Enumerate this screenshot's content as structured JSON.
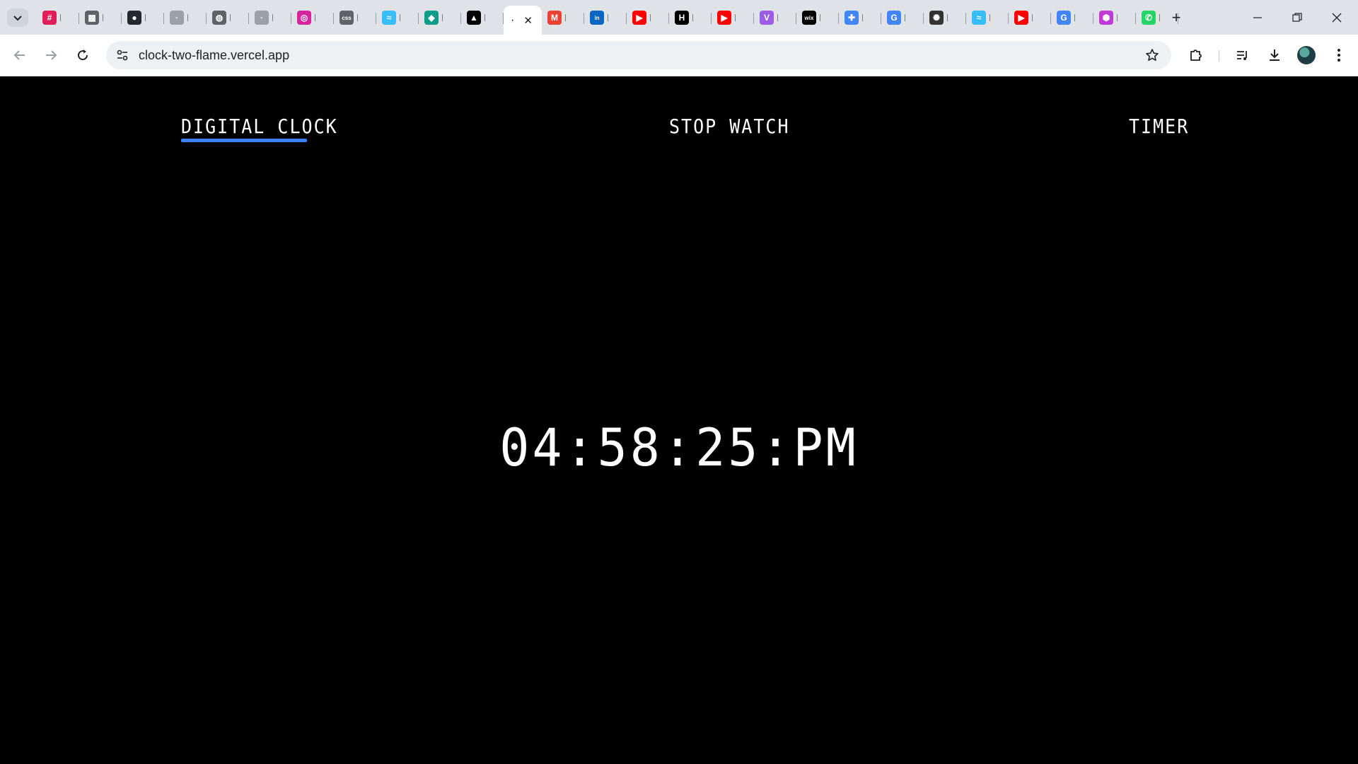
{
  "browser": {
    "tabs": [
      {
        "icon": "slack-icon",
        "color": "#e01e5a",
        "glyph": "#"
      },
      {
        "icon": "figma-icon",
        "color": "#5f6368",
        "glyph": "▦"
      },
      {
        "icon": "github-icon",
        "color": "#24292e",
        "glyph": "●"
      },
      {
        "icon": "blank-page-icon",
        "color": "#9aa0a6",
        "glyph": "·"
      },
      {
        "icon": "globe-icon",
        "color": "#5f6368",
        "glyph": "◍"
      },
      {
        "icon": "blank-page-icon",
        "color": "#9aa0a6",
        "glyph": "·"
      },
      {
        "icon": "instagram-icon",
        "color": "#d6249f",
        "glyph": "◎"
      },
      {
        "icon": "css-icon",
        "color": "#5f6368",
        "glyph": "css"
      },
      {
        "icon": "tailwind-icon",
        "color": "#38bdf8",
        "glyph": "≈"
      },
      {
        "icon": "kite-icon",
        "color": "#0f9d8a",
        "glyph": "◆"
      },
      {
        "icon": "triangle-app-icon",
        "color": "#000000",
        "glyph": "▲"
      },
      {
        "icon": "gmail-icon",
        "color": "#ea4335",
        "glyph": "M"
      },
      {
        "icon": "linkedin-icon",
        "color": "#0a66c2",
        "glyph": "in"
      },
      {
        "icon": "youtube-icon",
        "color": "#ff0000",
        "glyph": "▶"
      },
      {
        "icon": "hackernoon-icon",
        "color": "#000000",
        "glyph": "H"
      },
      {
        "icon": "youtube-icon",
        "color": "#ff0000",
        "glyph": "▶"
      },
      {
        "icon": "vite-icon",
        "color": "#9b5de5",
        "glyph": "V"
      },
      {
        "icon": "wix-icon",
        "color": "#000000",
        "glyph": "wix"
      },
      {
        "icon": "puzzle-app-icon",
        "color": "#4285f4",
        "glyph": "✚"
      },
      {
        "icon": "google-icon",
        "color": "#4285f4",
        "glyph": "G"
      },
      {
        "icon": "openai-icon",
        "color": "#333333",
        "glyph": "✺"
      },
      {
        "icon": "tailwind-icon",
        "color": "#38bdf8",
        "glyph": "≈"
      },
      {
        "icon": "youtube-icon",
        "color": "#ff0000",
        "glyph": "▶"
      },
      {
        "icon": "google-icon",
        "color": "#4285f4",
        "glyph": "G"
      },
      {
        "icon": "hex-app-icon",
        "color": "#c03bd6",
        "glyph": "⬢"
      },
      {
        "icon": "whatsapp-icon",
        "color": "#25d366",
        "glyph": "✆"
      }
    ],
    "active_tab_index": 11,
    "url": "clock-two-flame.vercel.app"
  },
  "app": {
    "nav": {
      "digital_clock": "DIGITAL CLOCK",
      "stop_watch": "STOP WATCH",
      "timer": "TIMER"
    },
    "active_nav": "digital_clock",
    "accent_color": "#3b82f6",
    "time": "04:58:25:PM"
  }
}
